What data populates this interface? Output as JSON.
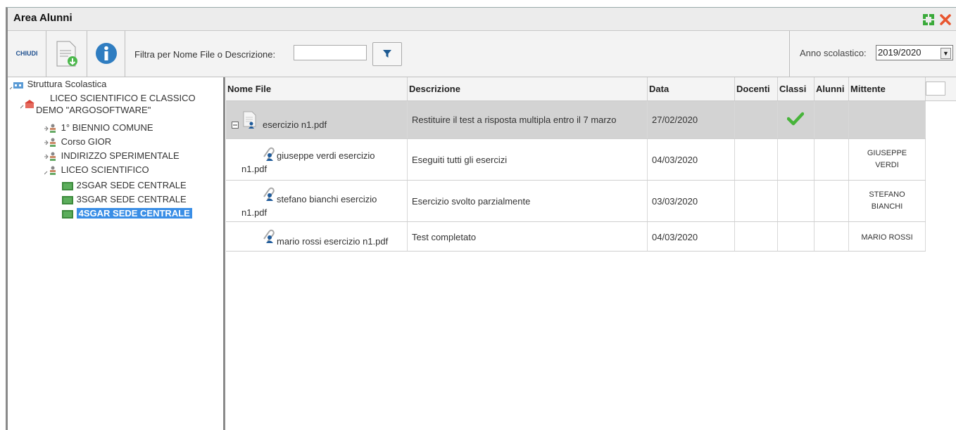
{
  "window": {
    "title": "Area Alunni"
  },
  "toolbar": {
    "close_label": "CHIUDI",
    "filter_label": "Filtra per Nome File o Descrizione:",
    "filter_value": "",
    "year_label": "Anno scolastico:",
    "year_value": "2019/2020"
  },
  "tree": {
    "root": "Struttura Scolastica",
    "school_line1": "LICEO SCIENTIFICO E CLASSICO",
    "school_line2": "DEMO \"ARGOSOFTWARE\"",
    "items": [
      {
        "label": "1° BIENNIO COMUNE"
      },
      {
        "label": "Corso GIOR"
      },
      {
        "label": "INDIRIZZO SPERIMENTALE"
      },
      {
        "label": "LICEO SCIENTIFICO"
      }
    ],
    "classes": [
      {
        "label": "2SGAR SEDE CENTRALE"
      },
      {
        "label": "3SGAR SEDE CENTRALE"
      },
      {
        "label": "4SGAR SEDE CENTRALE"
      }
    ]
  },
  "grid": {
    "columns": [
      "Nome File",
      "Descrizione",
      "Data",
      "Docenti",
      "Classi",
      "Alunni",
      "Mittente"
    ],
    "rows": [
      {
        "file": "esercizio n1.pdf",
        "desc": "Restituire il test a risposta multipla entro il 7 marzo",
        "date": "27/02/2020",
        "mittente": "",
        "classi_check": true
      },
      {
        "file_l1": "giuseppe verdi esercizio",
        "file_l2": "n1.pdf",
        "desc": "Eseguiti tutti gli esercizi",
        "date": "04/03/2020",
        "mitt_l1": "GIUSEPPE",
        "mitt_l2": "VERDI"
      },
      {
        "file_l1": "stefano bianchi esercizio",
        "file_l2": "n1.pdf",
        "desc": "Esercizio svolto parzialmente",
        "date": "03/03/2020",
        "mitt_l1": "STEFANO",
        "mitt_l2": "BIANCHI"
      },
      {
        "file": "mario rossi esercizio n1.pdf",
        "desc": "Test completato",
        "date": "04/03/2020",
        "mittente": "MARIO ROSSI"
      }
    ]
  }
}
